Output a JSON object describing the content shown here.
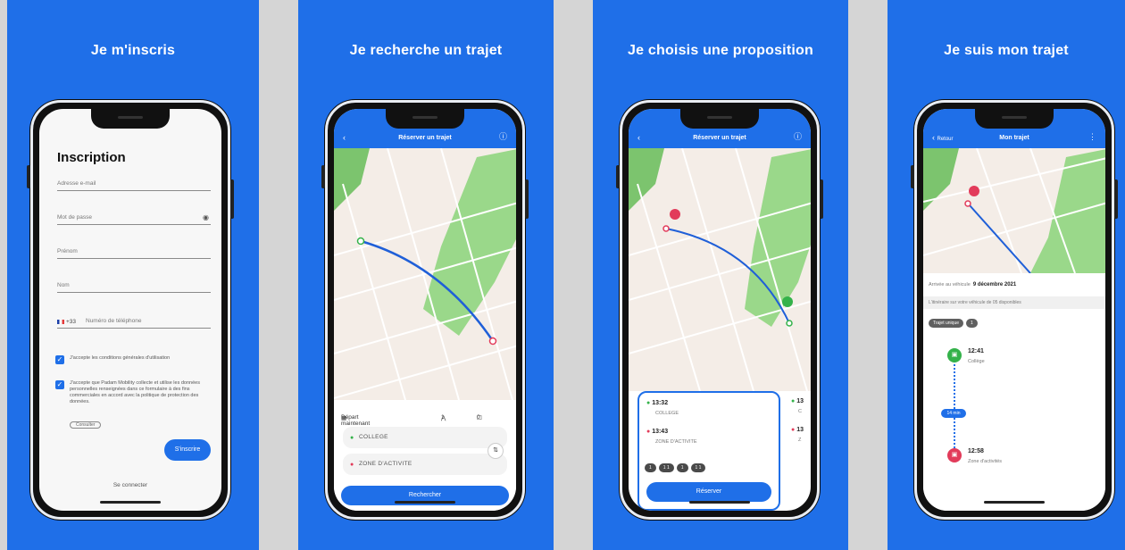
{
  "colors": {
    "brand_blue": "#1f6fe8",
    "map_bg": "#f4ede7",
    "park_green": "#9ad88a",
    "route_blue": "#1f5fd8",
    "stop_red": "#e23b5a",
    "stop_green": "#34b24a"
  },
  "panels": [
    {
      "title": "Je m'inscris"
    },
    {
      "title": "Je recherche un trajet"
    },
    {
      "title": "Je choisis une proposition"
    },
    {
      "title": "Je suis mon trajet"
    }
  ],
  "signup": {
    "heading": "Inscription",
    "email_placeholder": "Adresse e-mail",
    "password_placeholder": "Mot de passe",
    "firstname_placeholder": "Prénom",
    "lastname_placeholder": "Nom",
    "country_code": "+33",
    "phone_placeholder": "Numéro de téléphone",
    "terms_text": "J'accepte les conditions générales d'utilisation",
    "consent_text": "J'accepte que Padam Mobility collecte et utilise les données personnelles renseignées dans ce formulaire à des fins commerciales en accord avec la politique de protection des données.",
    "consent_link": "Consulter",
    "signup_button": "S'inscrire",
    "login_link": "Se connecter"
  },
  "search": {
    "appbar_title": "Réserver un trajet",
    "departure_option": "Départ maintenant",
    "passengers": "1",
    "bags": "0",
    "origin": "COLLEGE",
    "destination": "ZONE D'ACTIVITE",
    "search_button": "Rechercher"
  },
  "proposal": {
    "appbar_title": "Réserver un trajet",
    "depart_time": "13:32",
    "depart_stop": "COLLEGE",
    "arrive_time": "13:43",
    "arrive_stop": "ZONE D'ACTIVITE",
    "tags": [
      "1",
      "1 1",
      "1",
      "1 1"
    ],
    "peek_time_1": "13",
    "peek_stop_1": "C",
    "peek_time_2": "13",
    "peek_stop_2": "Z",
    "reserve_button": "Réserver"
  },
  "trip": {
    "back_label": "Retour",
    "appbar_title": "Mon trajet",
    "date_label": "Arrivée au véhicule",
    "date_value": "9 décembre 2021",
    "sub_text": "L'itinéraire sur votre véhicule de 05 disponibles",
    "chips": [
      "Trajet unique",
      "1"
    ],
    "start_time": "12:41",
    "start_stop": "Collège",
    "duration_badge": "14 min",
    "end_time": "12:58",
    "end_stop": "Zone d'activités"
  }
}
